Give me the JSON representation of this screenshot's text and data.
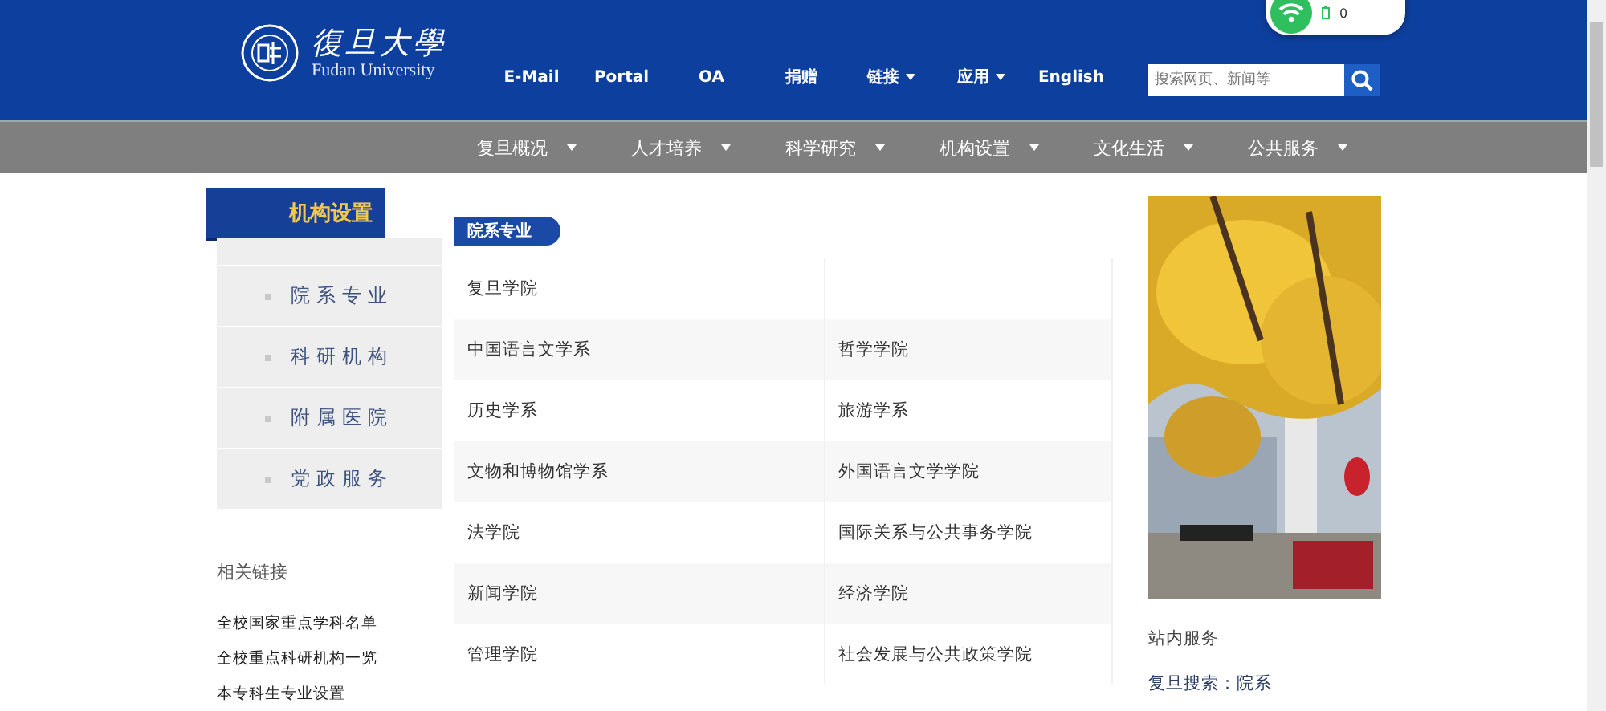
{
  "header": {
    "logo_name": "復旦大學",
    "logo_subtitle": "Fudan University",
    "links": [
      {
        "label": "E-Mail",
        "dropdown": false
      },
      {
        "label": "Portal",
        "dropdown": false
      },
      {
        "label": "OA",
        "dropdown": false
      },
      {
        "label": "捐赠",
        "dropdown": false
      },
      {
        "label": "链接",
        "dropdown": true
      },
      {
        "label": "应用",
        "dropdown": true
      },
      {
        "label": "English",
        "dropdown": false
      }
    ],
    "search": {
      "placeholder": "搜索网页、新闻等"
    }
  },
  "network_widget": {
    "count": "0"
  },
  "main_nav": [
    "复旦概况",
    "人才培养",
    "科学研究",
    "机构设置",
    "文化生活",
    "公共服务"
  ],
  "sidebar": {
    "title": "机构设置",
    "items": [
      "院系专业",
      "科研机构",
      "附属医院",
      "党政服务"
    ],
    "related_title": "相关链接",
    "related_links": [
      "全校国家重点学科名单",
      "全校重点科研机构一览",
      "本专科生专业设置"
    ]
  },
  "section": {
    "title": "院系专业",
    "rows": [
      [
        "复旦学院",
        ""
      ],
      [
        "中国语言文学系",
        "哲学学院"
      ],
      [
        "历史学系",
        "旅游学系"
      ],
      [
        "文物和博物馆学系",
        "外国语言文学学院"
      ],
      [
        "法学院",
        "国际关系与公共事务学院"
      ],
      [
        "新闻学院",
        "经济学院"
      ],
      [
        "管理学院",
        "社会发展与公共政策学院"
      ]
    ]
  },
  "aside": {
    "service_title": "站内服务",
    "search_link": "复旦搜索：院系"
  }
}
